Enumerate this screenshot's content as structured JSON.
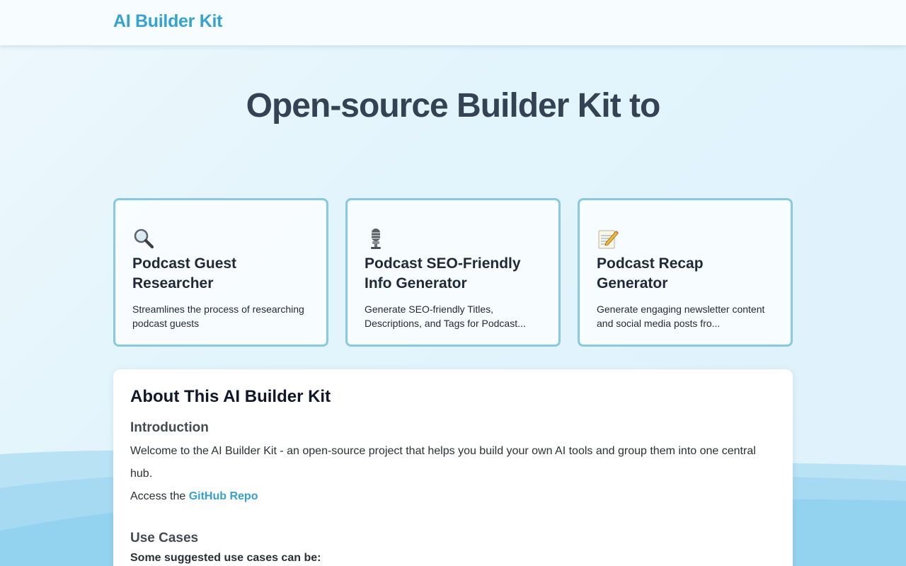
{
  "header": {
    "brand": "AI Builder Kit"
  },
  "hero": {
    "title": "Open-source Builder Kit to"
  },
  "cards": [
    {
      "icon": "magnifying-glass-icon",
      "title": "Podcast Guest Researcher",
      "description": "Streamlines the process of researching podcast guests"
    },
    {
      "icon": "microphone-icon",
      "title": "Podcast SEO-Friendly Info Generator",
      "description": "Generate SEO-friendly Titles, Descriptions, and Tags for Podcast..."
    },
    {
      "icon": "memo-icon",
      "title": "Podcast Recap Generator",
      "description": "Generate engaging newsletter content and social media posts fro..."
    }
  ],
  "about": {
    "title": "About This AI Builder Kit",
    "intro_heading": "Introduction",
    "intro_text": "Welcome to the AI Builder Kit - an open-source project that helps you build your own AI tools and group them into one central hub.",
    "access_prefix": "Access the ",
    "github_link": "GitHub Repo",
    "use_cases_heading": "Use Cases",
    "use_cases_intro": "Some suggested use cases can be:"
  },
  "colors": {
    "brand": "#35a2cf",
    "card_border": "#86c9e0",
    "heading": "#344254"
  }
}
